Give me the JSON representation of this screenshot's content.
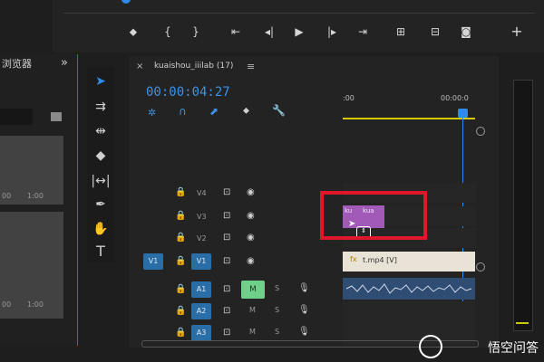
{
  "project_panel": {
    "title": "浏览器",
    "chevron": "»",
    "thumb_duration_1": "00",
    "thumb_time_1": "1:00",
    "thumb_duration_2": "00",
    "thumb_time_2": "1:00"
  },
  "sequence": {
    "close": "×",
    "name": "kuaishou_iiilab (17)",
    "menu": "≡",
    "timecode": "00:00:04:27",
    "ruler_start": ":00",
    "ruler_end": "00:00:0"
  },
  "tracks": {
    "video": [
      {
        "label": "V4"
      },
      {
        "label": "V3"
      },
      {
        "label": "V2"
      },
      {
        "label": "V1",
        "source_target": "V1"
      }
    ],
    "audio": [
      {
        "label": "A1",
        "mute": "M",
        "solo": "S"
      },
      {
        "label": "A2",
        "mute": "M",
        "solo": "S"
      },
      {
        "label": "A3",
        "mute": "M",
        "solo": "S"
      }
    ]
  },
  "clips": {
    "main_clip_label": "t.mp4 [V]",
    "fx_badge": "fx",
    "small_clip_a": "ku",
    "small_clip_b": "kua"
  },
  "watermark": {
    "text": "悟空问答"
  },
  "icons": {
    "add": "+"
  }
}
